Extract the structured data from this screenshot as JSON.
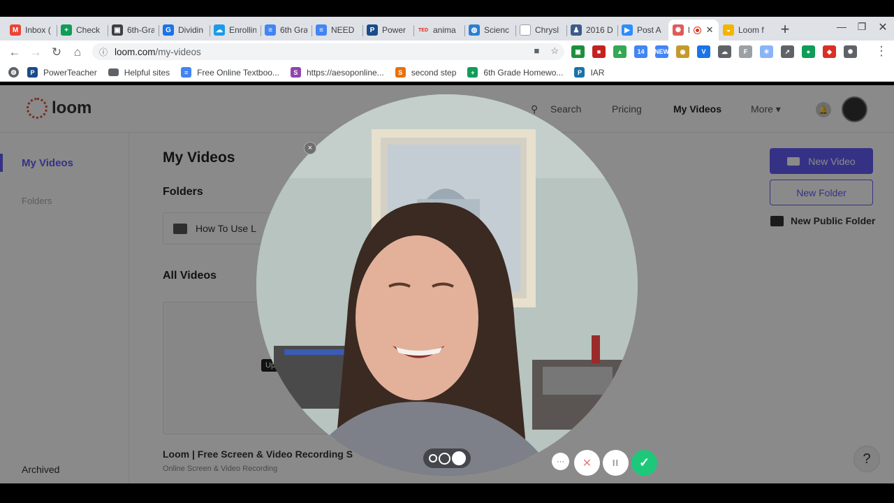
{
  "browser": {
    "tabs": [
      {
        "title": "Inbox (",
        "icon": "gmail-icon",
        "color": "#ea4335",
        "glyph": "M"
      },
      {
        "title": "Check",
        "icon": "sheets-icon",
        "color": "#0f9d58",
        "glyph": "+"
      },
      {
        "title": "6th-Gra",
        "icon": "classroom-icon",
        "color": "#3c4043",
        "glyph": "▣"
      },
      {
        "title": "Dividin",
        "icon": "app-g-icon",
        "color": "#1a73e8",
        "glyph": "G"
      },
      {
        "title": "Enrollin",
        "icon": "cloud-icon",
        "color": "#1a9be8",
        "glyph": "☁"
      },
      {
        "title": "6th Gra",
        "icon": "docs-icon",
        "color": "#4285f4",
        "glyph": "≡"
      },
      {
        "title": "NEED",
        "icon": "docs-icon",
        "color": "#4285f4",
        "glyph": "≡"
      },
      {
        "title": "Power",
        "icon": "powerschool-icon",
        "color": "#1a4c8a",
        "glyph": "P"
      },
      {
        "title": "anima",
        "icon": "ted-icon",
        "color": "#e62b1e",
        "glyph": "TED"
      },
      {
        "title": "Scienc",
        "icon": "globe-icon",
        "color": "#2a7fd4",
        "glyph": "◍"
      },
      {
        "title": "Chrysl",
        "icon": "document-icon",
        "color": "#dadce0",
        "glyph": ""
      },
      {
        "title": "2016 D",
        "icon": "person-icon",
        "color": "#3c5a8a",
        "glyph": "♟"
      },
      {
        "title": "Post A",
        "icon": "zoom-icon",
        "color": "#2d8cff",
        "glyph": "▶"
      },
      {
        "title": "l",
        "icon": "loom-icon",
        "color": "#e05a5a",
        "glyph": "✺",
        "active": true,
        "recording": true
      },
      {
        "title": "Loom f",
        "icon": "chrome-webstore-icon",
        "color": "#f4b400",
        "glyph": "◒"
      }
    ],
    "url_host": "loom.com",
    "url_path": "/my-videos",
    "extensions": [
      {
        "name": "classroom-ext-icon",
        "color": "#1e8e3e",
        "glyph": "▣"
      },
      {
        "name": "bookmark-ext-icon",
        "color": "#c5221f",
        "glyph": "■"
      },
      {
        "name": "drive-ext-icon",
        "color": "#34a853",
        "glyph": "▲"
      },
      {
        "name": "calendar-ext-icon",
        "color": "#4285f4",
        "glyph": "14"
      },
      {
        "name": "edit-ext-icon",
        "color": "#4285f4",
        "glyph": "NEW"
      },
      {
        "name": "palette-ext-icon",
        "color": "#c49a2c",
        "glyph": "◉"
      },
      {
        "name": "v-ext-icon",
        "color": "#1a73e8",
        "glyph": "V"
      },
      {
        "name": "cloud-ext-icon",
        "color": "#5f6368",
        "glyph": "☁"
      },
      {
        "name": "f-ext-icon",
        "color": "#9aa0a6",
        "glyph": "F"
      },
      {
        "name": "atom-ext-icon",
        "color": "#8ab4f8",
        "glyph": "✳"
      },
      {
        "name": "rocket-ext-icon",
        "color": "#5f6368",
        "glyph": "➚"
      },
      {
        "name": "hangouts-ext-icon",
        "color": "#0f9d58",
        "glyph": "●"
      },
      {
        "name": "shield-ext-icon",
        "color": "#d93025",
        "glyph": "◆"
      },
      {
        "name": "loom-ext-icon",
        "color": "#5f6368",
        "glyph": "✺"
      }
    ],
    "bookmarks": [
      {
        "label": "",
        "icon": "globe-icon",
        "color": "#5f6368",
        "glyph": "◍"
      },
      {
        "label": "PowerTeacher",
        "icon": "powerschool-icon",
        "color": "#1a4c8a",
        "glyph": "P"
      },
      {
        "label": "Helpful sites",
        "icon": "folder-icon",
        "color": "#5f6368",
        "glyph": ""
      },
      {
        "label": "Free Online Textboo...",
        "icon": "doc-icon",
        "color": "#4285f4",
        "glyph": "≡"
      },
      {
        "label": "https://aesoponline...",
        "icon": "aesop-icon",
        "color": "#8e44ad",
        "glyph": "S"
      },
      {
        "label": "second step",
        "icon": "second-step-icon",
        "color": "#e8710a",
        "glyph": "S"
      },
      {
        "label": "6th Grade Homewo...",
        "icon": "sheets-icon",
        "color": "#0f9d58",
        "glyph": "+"
      },
      {
        "label": "IAR",
        "icon": "iar-icon",
        "color": "#1a73a8",
        "glyph": "P"
      }
    ]
  },
  "loom": {
    "logo_text": "loom",
    "nav": {
      "search": "Search",
      "pricing": "Pricing",
      "my_videos": "My Videos",
      "more": "More"
    },
    "sidebar": {
      "my_videos": "My Videos",
      "folders": "Folders",
      "archived": "Archived"
    },
    "heading": "My Videos",
    "folders_heading": "Folders",
    "folder_name": "How To Use L",
    "all_videos_heading": "All Videos",
    "video_tag": "Up",
    "video_title": "Loom | Free Screen & Video Recording S",
    "video_subtitle": "Online Screen & Video Recording",
    "buttons": {
      "new_video": "New Video",
      "new_folder": "New Folder",
      "new_public_folder": "New Public Folder"
    },
    "help": "?",
    "accent_color": "#625df5"
  },
  "recorder": {
    "close": "×",
    "more": "···",
    "cancel": "✕",
    "pause": "II",
    "finish": "✓"
  }
}
